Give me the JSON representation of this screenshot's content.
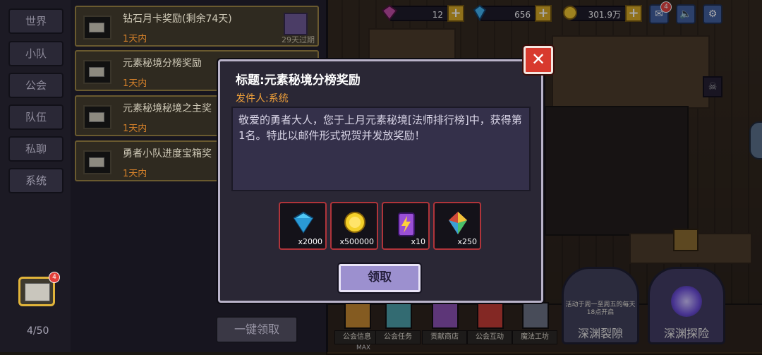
{
  "resources": {
    "gems_purple": "12",
    "diamonds": "656",
    "gold": "301.9万",
    "mail_badge": "4"
  },
  "tabs": [
    "世界",
    "小队",
    "公会",
    "队伍",
    "私聊",
    "系统"
  ],
  "mail_list": [
    {
      "title": "钻石月卡奖励(剩余74天)",
      "time": "1天内",
      "expire": "29天过期"
    },
    {
      "title": "元素秘境分榜奖励",
      "time": "1天内",
      "expire": ""
    },
    {
      "title": "元素秘境秘境之主奖",
      "time": "1天内",
      "expire": ""
    },
    {
      "title": "勇者小队进度宝箱奖",
      "time": "1天内",
      "expire": ""
    }
  ],
  "mail_footer": {
    "count": "4/50",
    "one_key_claim": "一键领取",
    "mail_badge": "4"
  },
  "dialog": {
    "title": "标题:元素秘境分榜奖励",
    "sender": "发件人:系统",
    "body": "敬爱的勇者大人，您于上月元素秘境[法师排行榜]中，获得第1名。特此以邮件形式祝贺并发放奖励！",
    "rewards": [
      {
        "icon": "diamond-icon",
        "qty": "x2000"
      },
      {
        "icon": "gold-coin-icon",
        "qty": "x500000"
      },
      {
        "icon": "energy-battery-icon",
        "qty": "x10"
      },
      {
        "icon": "element-crystal-icon",
        "qty": "x250"
      }
    ],
    "claim_label": "领取",
    "close_label": "✕"
  },
  "bottom_buttons": [
    "公会信息",
    "公会任务",
    "贡献商店",
    "公会互动",
    "魔法工坊"
  ],
  "portals": [
    {
      "label": "深渊裂隙",
      "note": "活动于周一至周五的每天18点开启"
    },
    {
      "label": "深渊探险",
      "note": ""
    }
  ],
  "max_label": "MAX",
  "colors": {
    "accent_orange": "#f2a23a",
    "close_red": "#d83a2e",
    "reward_border": "#b0343a",
    "claim_purple": "#9c90cf"
  }
}
